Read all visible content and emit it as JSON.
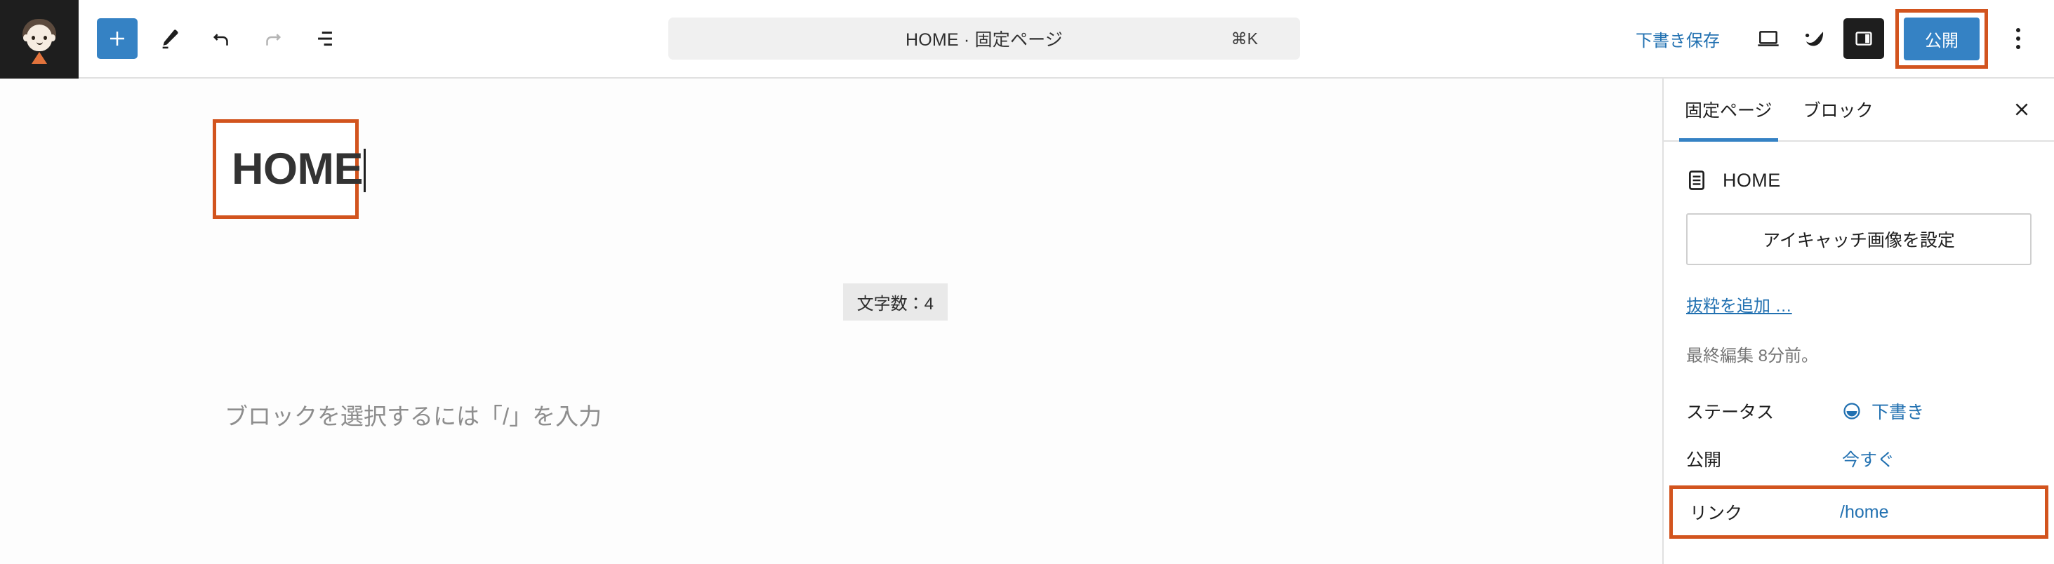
{
  "topbar": {
    "logo": {
      "icon": "wordpress-avatar-icon"
    },
    "tools": {
      "add_block_label": "+",
      "add_block_name": "ブロックを追加",
      "edit_tool_name": "ツール",
      "undo_name": "元に戻す",
      "redo_name": "やり直し",
      "outline_name": "文書の概要"
    },
    "command_bar": {
      "title": "HOME · 固定ページ",
      "shortcut": "⌘K"
    },
    "actions": {
      "save_draft": "下書き保存",
      "view_device_name": "表示",
      "preview_name": "プレビュー",
      "settings_toggle_name": "設定",
      "publish": "公開",
      "options_name": "オプション"
    }
  },
  "canvas": {
    "post_title": "HOME",
    "char_count_badge": "文字数：4",
    "block_placeholder": "ブロックを選択するには「/」を入力"
  },
  "sidebar": {
    "tabs": [
      {
        "label": "固定ページ",
        "active": true
      },
      {
        "label": "ブロック",
        "active": false
      }
    ],
    "close_label": "×",
    "document": {
      "title": "HOME",
      "icon": "page-document-icon"
    },
    "featured_image_button": "アイキャッチ画像を設定",
    "excerpt_link": "抜粋を追加 …",
    "last_edited": "最終編集 8分前。",
    "rows": [
      {
        "label": "ステータス",
        "value": "下書き",
        "icon": "draft-status-icon"
      },
      {
        "label": "公開",
        "value": "今すぐ",
        "icon": ""
      },
      {
        "label": "リンク",
        "value": "/home",
        "icon": ""
      }
    ]
  },
  "colors": {
    "accent_blue": "#3582c4",
    "link_blue": "#2271b1",
    "highlight_orange": "#d2541e",
    "dark": "#1e1e1e",
    "muted": "#757575"
  }
}
